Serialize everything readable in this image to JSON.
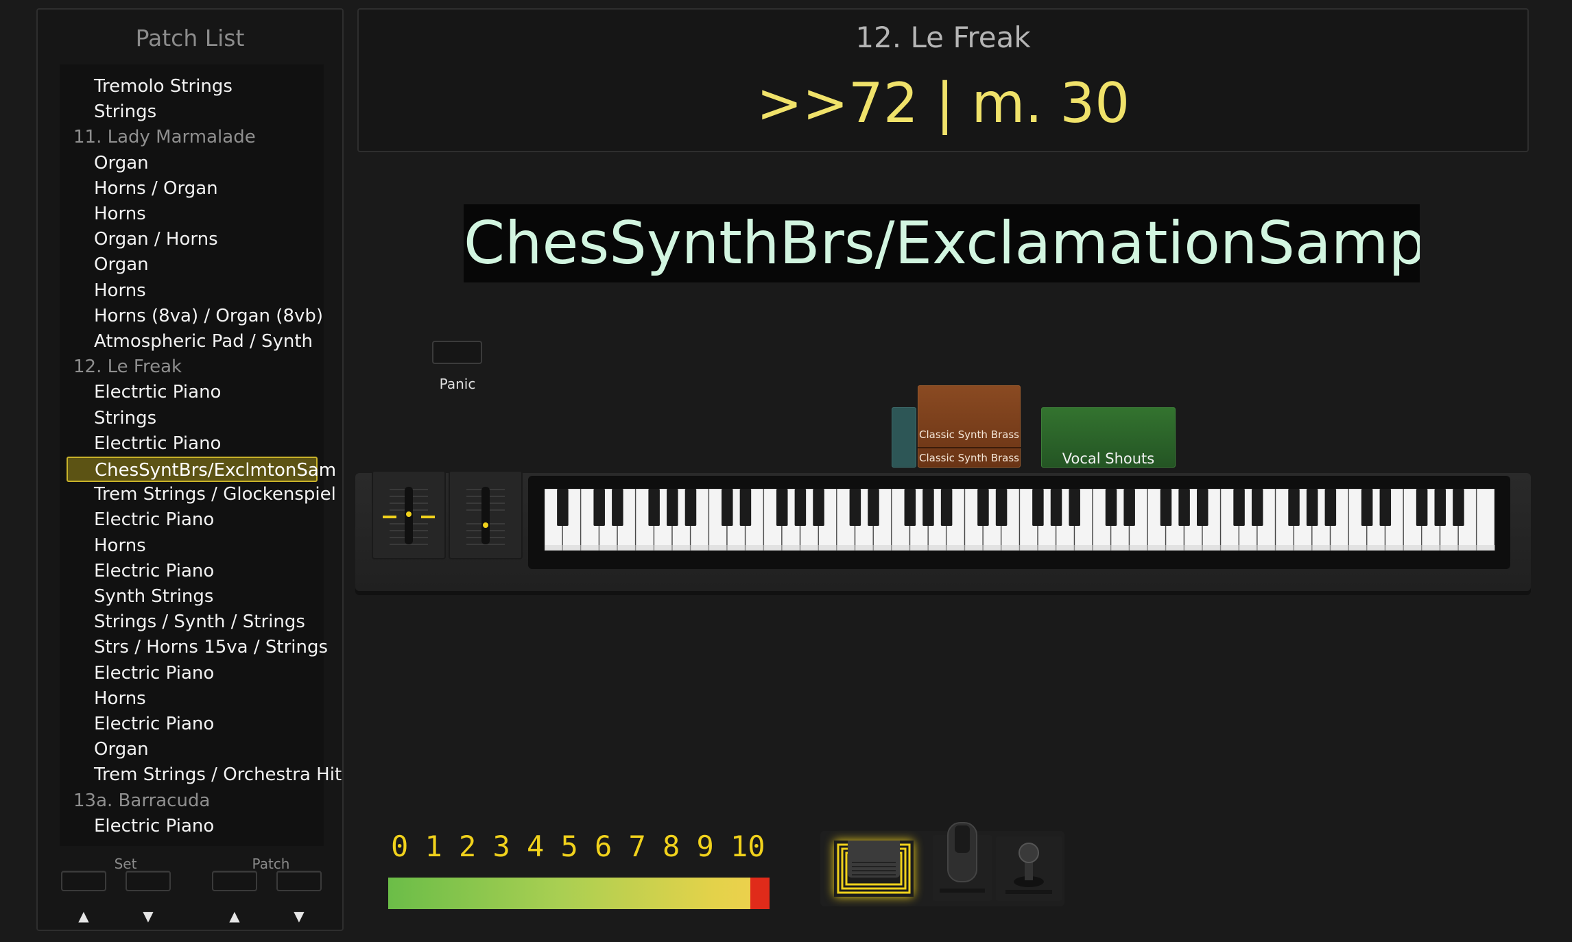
{
  "patch_list": {
    "title": "Patch List",
    "items": [
      {
        "label": "Tremolo Strings",
        "kind": "patch"
      },
      {
        "label": "Strings",
        "kind": "patch"
      },
      {
        "label": "11. Lady Marmalade",
        "kind": "song"
      },
      {
        "label": "Organ",
        "kind": "patch"
      },
      {
        "label": "Horns / Organ",
        "kind": "patch"
      },
      {
        "label": "Horns",
        "kind": "patch"
      },
      {
        "label": "Organ / Horns",
        "kind": "patch"
      },
      {
        "label": "Organ",
        "kind": "patch"
      },
      {
        "label": "Horns",
        "kind": "patch"
      },
      {
        "label": "Horns (8va) / Organ (8vb)",
        "kind": "patch"
      },
      {
        "label": "Atmospheric Pad / Synth",
        "kind": "patch"
      },
      {
        "label": "12. Le Freak",
        "kind": "song"
      },
      {
        "label": "Electrtic Piano",
        "kind": "patch"
      },
      {
        "label": "Strings",
        "kind": "patch"
      },
      {
        "label": "Electrtic Piano",
        "kind": "patch"
      },
      {
        "label": "ChesSyntBrs/ExclmtonSam",
        "kind": "patch",
        "selected": true
      },
      {
        "label": "Trem Strings / Glockenspiel",
        "kind": "patch"
      },
      {
        "label": "Electric Piano",
        "kind": "patch"
      },
      {
        "label": "Horns",
        "kind": "patch"
      },
      {
        "label": "Electric Piano",
        "kind": "patch"
      },
      {
        "label": "Synth Strings",
        "kind": "patch"
      },
      {
        "label": "Strings / Synth / Strings",
        "kind": "patch"
      },
      {
        "label": "Strs / Horns 15va / Strings",
        "kind": "patch"
      },
      {
        "label": "Electric Piano",
        "kind": "patch"
      },
      {
        "label": "Horns",
        "kind": "patch"
      },
      {
        "label": "Electric Piano",
        "kind": "patch"
      },
      {
        "label": "Organ",
        "kind": "patch"
      },
      {
        "label": "Trem Strings / Orchestra Hit",
        "kind": "patch"
      },
      {
        "label": "13a. Barracuda",
        "kind": "song"
      },
      {
        "label": "Electric Piano",
        "kind": "patch"
      }
    ]
  },
  "nav": {
    "set_label": "Set",
    "patch_label": "Patch",
    "up_arrow": "▲",
    "down_arrow": "▼"
  },
  "header": {
    "song_title": "12. Le Freak",
    "measure_display": ">>72 | m. 30"
  },
  "patch_name": "ChesSynthBrs/ExclamationSamples",
  "panic": {
    "label": "Panic"
  },
  "layers": {
    "small_teal_label": "",
    "classic_synth_brass_1": "Classic Synth Brass",
    "classic_synth_brass_2": "Classic Synth Brass",
    "vocal_shouts": "Vocal Shouts"
  },
  "volume_meter": {
    "scale": [
      "0",
      "1",
      "2",
      "3",
      "4",
      "5",
      "6",
      "7",
      "8",
      "9",
      "10"
    ],
    "level": 1.0
  },
  "colors": {
    "accent_yellow": "#f0e26a",
    "patch_name_text": "#d2f5e0",
    "selected_border": "#c9b32a",
    "meter_peak": "#e02b1a",
    "brass_layer": "#8a4a22",
    "vocal_layer": "#2f6a2c",
    "teal_layer": "#2d5656"
  },
  "icons": {
    "pitch_wheel": "pitch-wheel-icon",
    "mod_wheel": "mod-wheel-icon",
    "sustain_pedal": "sustain-pedal-icon",
    "expression_pedal": "expression-pedal-icon",
    "joystick": "joystick-icon"
  }
}
